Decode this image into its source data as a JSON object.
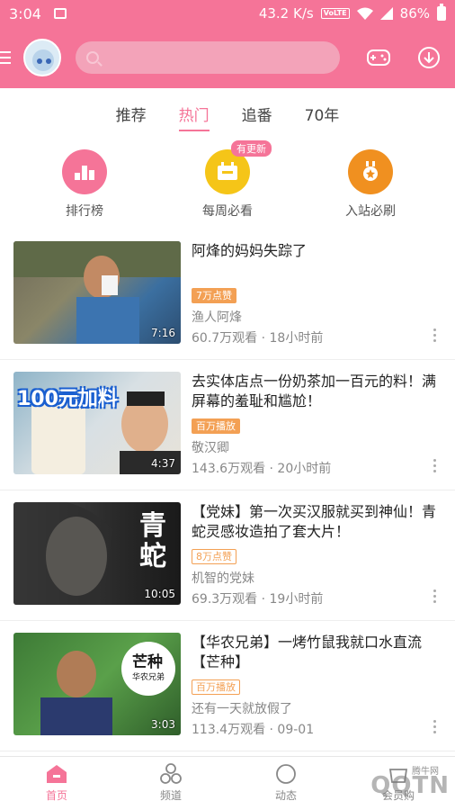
{
  "status_bar": {
    "time": "3:04",
    "speed": "43.2 K/s",
    "volte": "VoLTE",
    "battery": "86%"
  },
  "tabs": [
    {
      "label": "推荐",
      "active": false
    },
    {
      "label": "热门",
      "active": true
    },
    {
      "label": "追番",
      "active": false
    },
    {
      "label": "70年",
      "active": false
    }
  ],
  "quick_entries": [
    {
      "label": "排行榜",
      "icon": "ranking-icon",
      "color": "#f57498"
    },
    {
      "label": "每周必看",
      "icon": "calendar-icon",
      "color": "#f5c518",
      "badge": "有更新"
    },
    {
      "label": "入站必刷",
      "icon": "medal-icon",
      "color": "#f09020"
    }
  ],
  "videos": [
    {
      "title": "阿烽的妈妈失踪了",
      "tag": "7万点赞",
      "tag_style": "fill",
      "author": "渔人阿烽",
      "stats": "60.7万观看 · 18小时前",
      "duration": "7:16"
    },
    {
      "title": "去实体店点一份奶茶加一百元的料！满屏幕的羞耻和尴尬！",
      "tag": "百万播放",
      "tag_style": "fill",
      "author": "敬汉卿",
      "stats": "143.6万观看 · 20小时前",
      "duration": "4:37",
      "thumb_text": "100元加料"
    },
    {
      "title": "【党妹】第一次买汉服就买到神仙！青蛇灵感妆造拍了套大片！",
      "tag": "8万点赞",
      "tag_style": "outline",
      "author": "机智的党妹",
      "stats": "69.3万观看 · 19小时前",
      "duration": "10:05",
      "thumb_text": "青蛇"
    },
    {
      "title": "【华农兄弟】一烤竹鼠我就口水直流【芒种】",
      "tag": "百万播放",
      "tag_style": "outline",
      "author": "还有一天就放假了",
      "stats": "113.4万观看 · 09-01",
      "duration": "3:03",
      "thumb_text": "芒种",
      "thumb_subtext": "华农兄弟"
    }
  ],
  "bottom_nav": [
    {
      "label": "首页",
      "icon": "home-icon",
      "active": true
    },
    {
      "label": "频道",
      "icon": "channel-icon",
      "active": false
    },
    {
      "label": "动态",
      "icon": "dynamic-icon",
      "active": false
    },
    {
      "label": "会员购",
      "icon": "shop-icon",
      "active": false
    }
  ],
  "watermark": "QQTN",
  "watermark_small": "腾牛网",
  "colors": {
    "brand": "#f57498",
    "tag": "#f3a054"
  }
}
